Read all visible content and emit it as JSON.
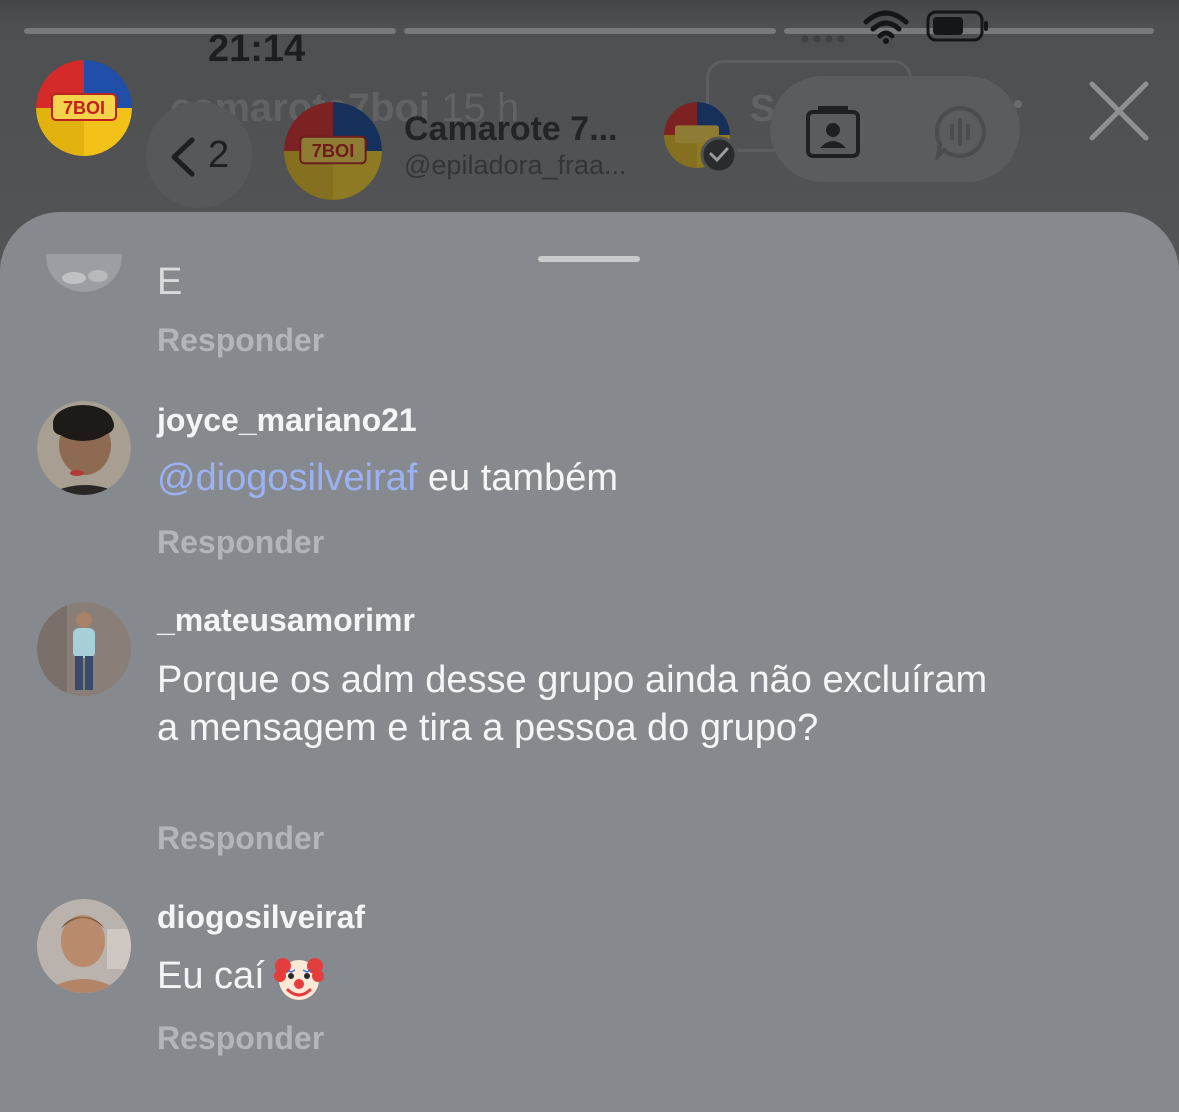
{
  "status_bar": {
    "time": "21:14"
  },
  "story_header": {
    "username": "camarote7boi",
    "age": "15 h",
    "follow_label": "Seguir",
    "logo_text": "7BOI"
  },
  "chat_header": {
    "back_count": "2",
    "name": "Camarote 7...",
    "handle": "@epiladora_fraa..."
  },
  "comments": [
    {
      "username": "",
      "text_prefix": "",
      "text": "E",
      "reply_label": "Responder"
    },
    {
      "username": "joyce_mariano21",
      "mention": "@diogosilveiraf",
      "text": " eu também",
      "reply_label": "Responder"
    },
    {
      "username": "_mateusamorimr",
      "text": "Porque os adm desse grupo ainda não excluíram a mensagem e tira a pessoa do grupo?",
      "reply_label": "Responder"
    },
    {
      "username": "diogosilveiraf",
      "text": "Eu caí",
      "emoji_icon": "clown-face-icon",
      "reply_label": "Responder"
    }
  ],
  "colors": {
    "sheet": "#868a8e",
    "mention": "#9cb0f4",
    "logo_red": "#d42a2a",
    "logo_blue": "#1f4fa8",
    "logo_yellow": "#f2c21a"
  }
}
